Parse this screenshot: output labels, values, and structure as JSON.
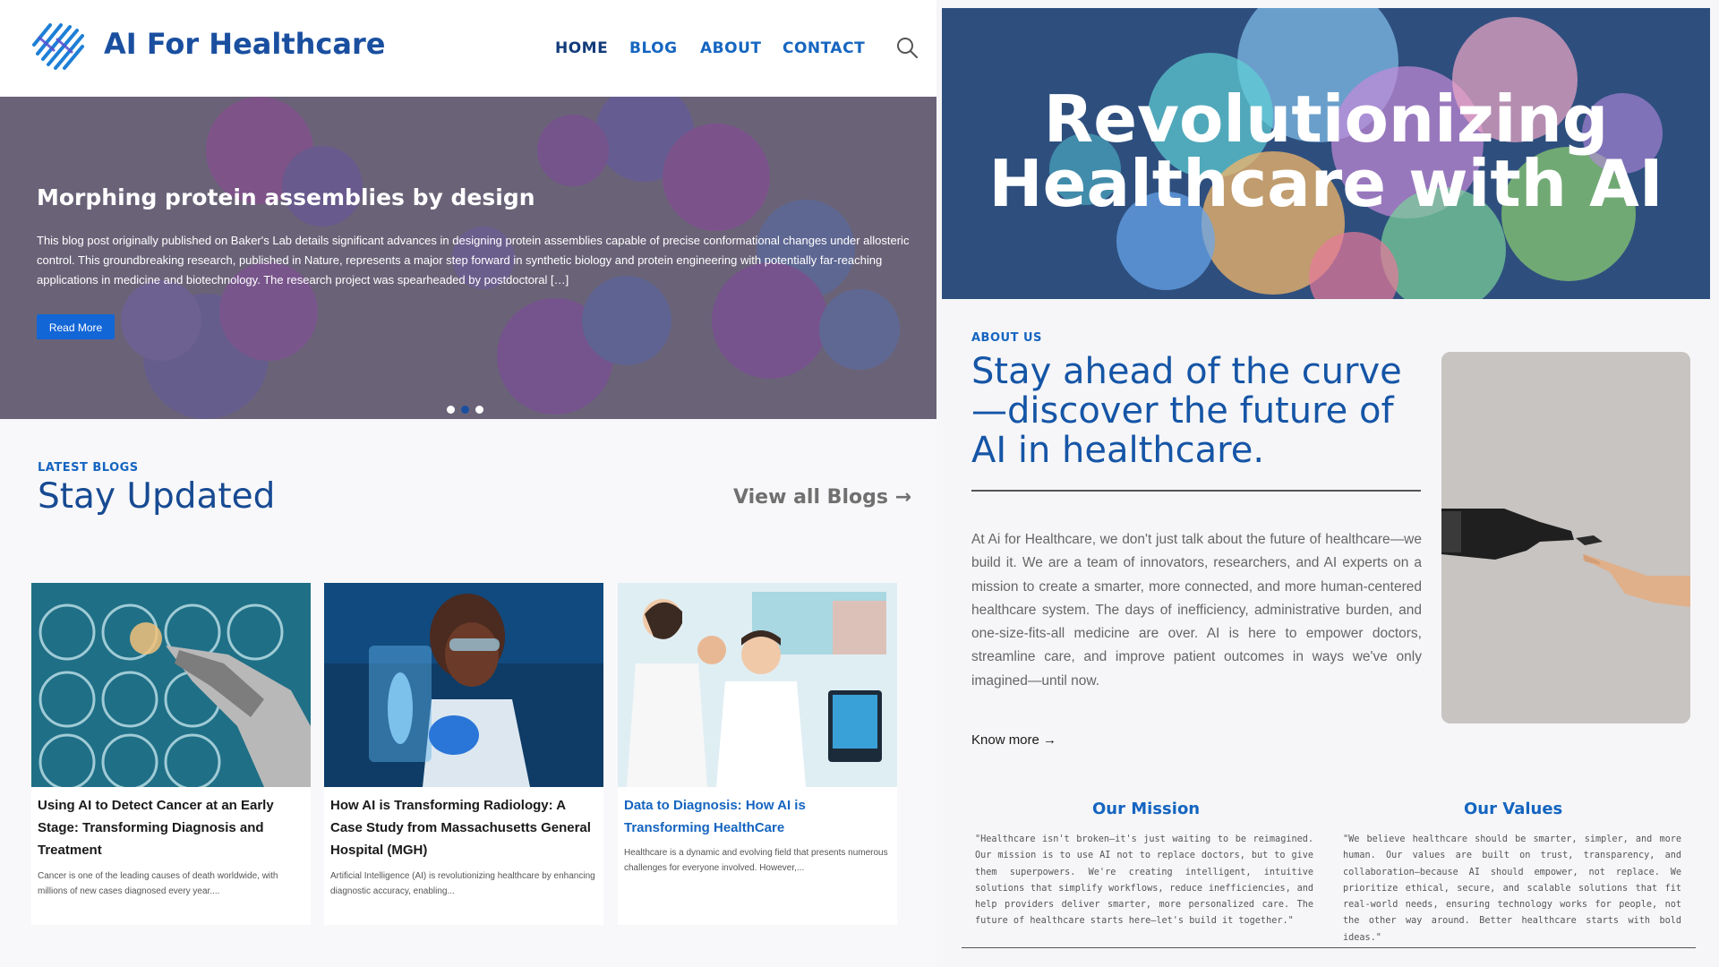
{
  "header": {
    "brand": "AI For Healthcare",
    "nav": [
      "HOME",
      "BLOG",
      "ABOUT",
      "CONTACT"
    ]
  },
  "hero": {
    "title": "Morphing protein assemblies by design",
    "body": "This blog post originally published on Baker's Lab details significant advances in designing protein assemblies capable of precise conformational changes under allosteric control. This groundbreaking research, published in Nature, represents a major step forward in synthetic biology and protein engineering with potentially far-reaching applications in medicine and biotechnology. The research project was spearheaded by postdoctoral […]",
    "button": "Read More",
    "slides": 3,
    "active_slide": 2
  },
  "latest": {
    "label": "LATEST BLOGS",
    "title": "Stay Updated",
    "view_all": "View all Blogs →"
  },
  "cards": [
    {
      "title": "Using AI to Detect Cancer at an Early Stage: Transforming Diagnosis and Treatment",
      "desc": "Cancer is one of the leading causes of death worldwide, with millions of new cases diagnosed every year...."
    },
    {
      "title": "How AI is Transforming Radiology: A Case Study from Massachusetts General Hospital (MGH)",
      "desc": "Artificial Intelligence (AI) is revolutionizing healthcare by enhancing diagnostic accuracy, enabling..."
    },
    {
      "title": "Data to Diagnosis: How AI is Transforming HealthCare",
      "desc": "Healthcare is a dynamic and evolving field that presents numerous challenges for everyone involved. However,..."
    }
  ],
  "banner": {
    "line1": "Revolutionizing",
    "line2": "Healthcare with AI"
  },
  "about": {
    "label": "ABOUT US",
    "heading": "Stay ahead of the curve—discover the future of AI in healthcare.",
    "body": "At Ai for Healthcare, we don't just talk about the future of healthcare—we build it. We are a team of innovators, researchers, and AI experts on a mission to create a smarter, more connected, and more human-centered healthcare system. The days of inefficiency, administrative burden, and one-size-fits-all medicine are over. AI is here to empower doctors, streamline care, and improve patient outcomes in ways we've only imagined—until now.",
    "know_more": "Know more →"
  },
  "mission": {
    "title": "Our Mission",
    "text": "\"Healthcare isn't broken—it's just waiting to be reimagined. Our mission is to use AI not to replace doctors, but to give them superpowers. We're creating intelligent, intuitive solutions that simplify workflows, reduce inefficiencies, and help providers deliver smarter, more personalized care. The future of healthcare starts here—let's build it together.\""
  },
  "values": {
    "title": "Our Values",
    "text": "\"We believe healthcare should be smarter, simpler, and more human. Our values are built on trust, transparency, and collaboration—because AI should empower, not replace. We prioritize ethical, secure, and scalable solutions that fit real-world needs, ensuring technology works for people, not the other way around. Better healthcare starts with bold ideas.\""
  },
  "colors": {
    "brand_blue": "#1a4fa0",
    "accent_blue": "#1565c0",
    "button_blue": "#1266d6"
  },
  "icons": [
    "logo-mark-icon",
    "search-icon",
    "arrow-right-icon"
  ]
}
